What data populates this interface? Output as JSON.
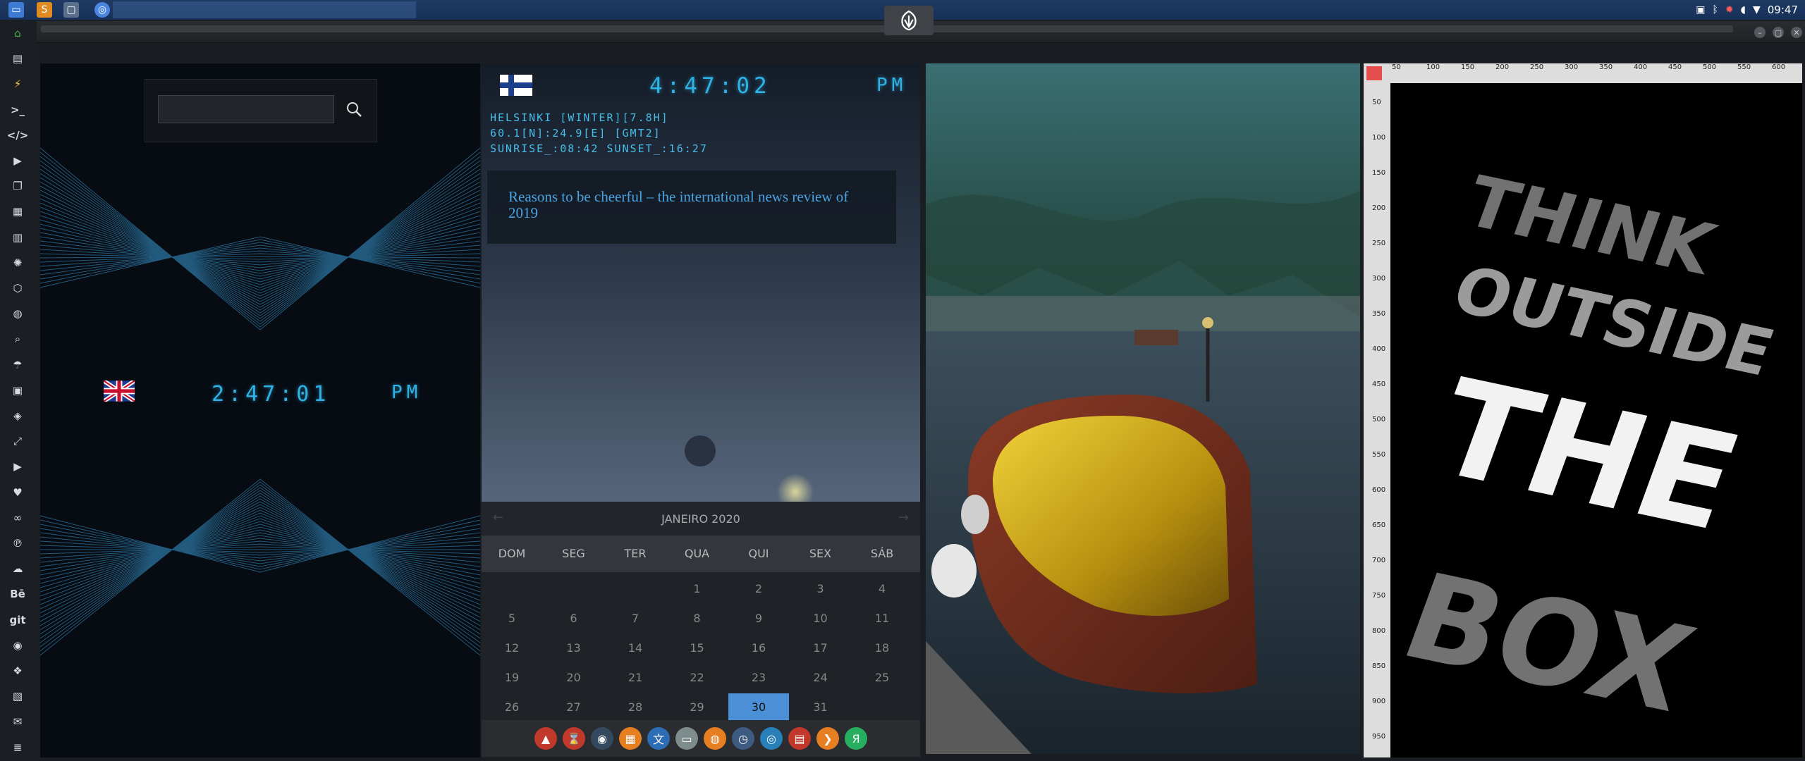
{
  "topbar": {
    "clock": "09:47",
    "apps": [
      "files-icon",
      "sublime-icon",
      "blank-window-icon",
      "chrome-icon"
    ],
    "tray_icons": [
      "image-icon",
      "bluetooth-icon",
      "update-icon",
      "volume-icon",
      "wifi-icon"
    ]
  },
  "launcher": {
    "items": [
      {
        "icon": "home-icon",
        "glyph": "⌂"
      },
      {
        "icon": "document-icon",
        "glyph": "▤"
      },
      {
        "icon": "lightning-icon",
        "glyph": "⚡"
      },
      {
        "icon": "terminal-icon",
        "glyph": ">_"
      },
      {
        "icon": "code-icon",
        "glyph": "</>"
      },
      {
        "icon": "play-icon",
        "glyph": "▶"
      },
      {
        "icon": "copy-icon",
        "glyph": "❐"
      },
      {
        "icon": "image-icon",
        "glyph": "▦"
      },
      {
        "icon": "newspaper-icon",
        "glyph": "▥"
      },
      {
        "icon": "aperture-icon",
        "glyph": "✺"
      },
      {
        "icon": "hexagon-icon",
        "glyph": "⬡"
      },
      {
        "icon": "globe-icon",
        "glyph": "◍"
      },
      {
        "icon": "search-icon",
        "glyph": "⌕"
      },
      {
        "icon": "umbrella-icon",
        "glyph": "☂"
      },
      {
        "icon": "contacts-icon",
        "glyph": "▣"
      },
      {
        "icon": "tag-icon",
        "glyph": "◈"
      },
      {
        "icon": "expand-icon",
        "glyph": "⤢"
      },
      {
        "icon": "youtube-icon",
        "glyph": "▶"
      },
      {
        "icon": "heart-icon",
        "glyph": "♥"
      },
      {
        "icon": "infinity-icon",
        "glyph": "∞"
      },
      {
        "icon": "pinterest-icon",
        "glyph": "℗"
      },
      {
        "icon": "cloud-icon",
        "glyph": "☁"
      },
      {
        "icon": "behance-icon",
        "glyph": "Bē"
      },
      {
        "icon": "git-icon",
        "glyph": "git"
      },
      {
        "icon": "github-icon",
        "glyph": "◉"
      },
      {
        "icon": "cubes-icon",
        "glyph": "❖"
      },
      {
        "icon": "map-icon",
        "glyph": "▧"
      },
      {
        "icon": "mail-icon",
        "glyph": "✉"
      },
      {
        "icon": "server-icon",
        "glyph": "≣"
      }
    ]
  },
  "uk_clock": {
    "time": "2:47:01",
    "ampm": "PM"
  },
  "search": {
    "placeholder": ""
  },
  "fi_clock": {
    "time": "4:47:02",
    "ampm": "PM",
    "line1": "HELSINKI [WINTER][7.8H]",
    "line2": "60.1[N]:24.9[E] [GMT2]",
    "line3": "SUNRISE_:08:42 SUNSET_:16:27"
  },
  "news": {
    "headline": "Reasons to be cheerful – the international news review of 2019"
  },
  "calendar": {
    "month_label": "JANEIRO 2020",
    "prev": "←",
    "next": "→",
    "day_names": [
      "DOM",
      "SEG",
      "TER",
      "QUA",
      "QUI",
      "SEX",
      "SÁB"
    ],
    "weeks": [
      [
        "",
        "",
        "",
        "1",
        "2",
        "3",
        "4"
      ],
      [
        "5",
        "6",
        "7",
        "8",
        "9",
        "10",
        "11"
      ],
      [
        "12",
        "13",
        "14",
        "15",
        "16",
        "17",
        "18"
      ],
      [
        "19",
        "20",
        "21",
        "22",
        "23",
        "24",
        "25"
      ],
      [
        "26",
        "27",
        "28",
        "29",
        "30",
        "31",
        ""
      ]
    ],
    "today": "30"
  },
  "dock": {
    "items": [
      {
        "icon": "vlc-icon",
        "glyph": "▲",
        "color": "#c0392b"
      },
      {
        "icon": "timer-icon",
        "glyph": "⌛",
        "color": "#c0392b"
      },
      {
        "icon": "planet-icon",
        "glyph": "◉",
        "color": "#34495e"
      },
      {
        "icon": "image-viewer-icon",
        "glyph": "▦",
        "color": "#e67e22"
      },
      {
        "icon": "translate-icon",
        "glyph": "文",
        "color": "#2c6db5"
      },
      {
        "icon": "presentation-icon",
        "glyph": "▭",
        "color": "#7f8c8d"
      },
      {
        "icon": "search-tool-icon",
        "glyph": "◍",
        "color": "#e67e22"
      },
      {
        "icon": "clock-icon",
        "glyph": "◷",
        "color": "#3d5a80"
      },
      {
        "icon": "web-icon",
        "glyph": "◎",
        "color": "#2980b9"
      },
      {
        "icon": "calendar-icon",
        "glyph": "▤",
        "color": "#c0392b"
      },
      {
        "icon": "arrow-icon",
        "glyph": "❯",
        "color": "#e67e22"
      },
      {
        "icon": "yandex-icon",
        "glyph": "Я",
        "color": "#27ae60"
      }
    ]
  },
  "ruler": {
    "top": [
      "50",
      "100",
      "150",
      "200",
      "250",
      "300",
      "350",
      "400",
      "450",
      "500",
      "550",
      "600"
    ],
    "left": [
      "50",
      "100",
      "150",
      "200",
      "250",
      "300",
      "350",
      "400",
      "450",
      "500",
      "550",
      "600",
      "650",
      "700",
      "750",
      "800",
      "850",
      "900",
      "950"
    ]
  },
  "poster": {
    "word1": "THINK",
    "word2": "OUTSIDE",
    "word3": "THE",
    "word4": "BOX"
  }
}
